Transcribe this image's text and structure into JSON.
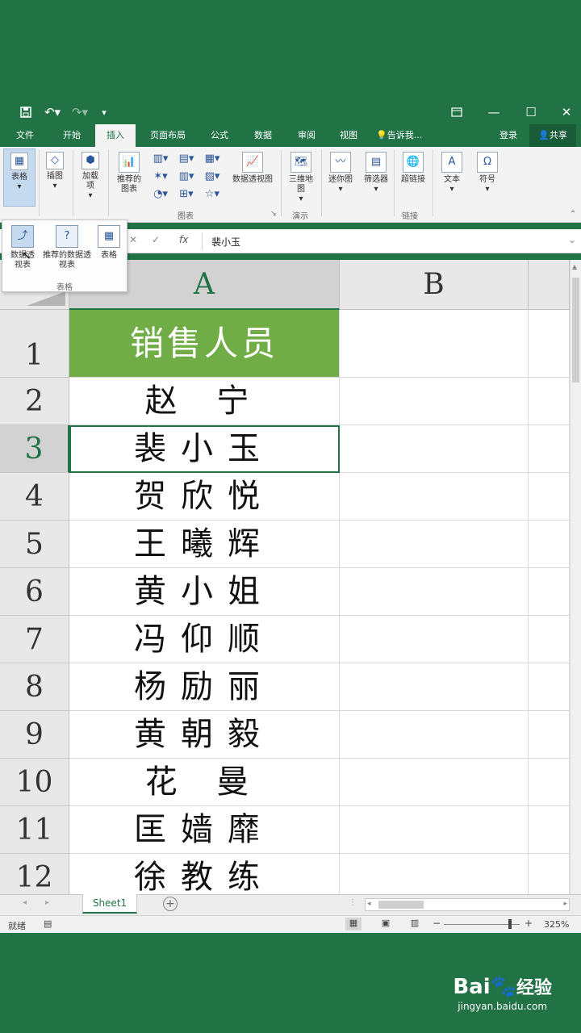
{
  "titlebar": {
    "save_icon": "save-icon",
    "undo_icon": "undo-icon",
    "redo_icon": "redo-icon"
  },
  "tabs": [
    "文件",
    "开始",
    "插入",
    "页面布局",
    "公式",
    "数据",
    "审阅",
    "视图"
  ],
  "tell_me": "告诉我...",
  "login": "登录",
  "share": "共享",
  "ribbon": {
    "table": "表格",
    "picture": "插图",
    "addins": "加载项",
    "recommended_charts": "推荐的图表",
    "pivot_chart": "数据透视图",
    "map3d": "三维地图",
    "sparkline": "迷你图",
    "slicer": "筛选器",
    "hyperlink": "超链接",
    "text": "文本",
    "symbol": "符号",
    "group_charts": "图表",
    "group_demo": "演示",
    "group_links": "链接"
  },
  "dropdown": {
    "pivot_table": "数据透视表",
    "recommended_pivot": "推荐的数据透视表",
    "table": "表格",
    "group_label": "表格"
  },
  "formula_bar": {
    "fx": "fx",
    "value": "裴小玉"
  },
  "columns": [
    "A",
    "B"
  ],
  "rows": [
    {
      "n": "1",
      "a": "销售人员"
    },
    {
      "n": "2",
      "a": "赵 宁"
    },
    {
      "n": "3",
      "a": "裴小玉"
    },
    {
      "n": "4",
      "a": "贺欣悦"
    },
    {
      "n": "5",
      "a": "王曦辉"
    },
    {
      "n": "6",
      "a": "黄小姐"
    },
    {
      "n": "7",
      "a": "冯仰顺"
    },
    {
      "n": "8",
      "a": "杨励丽"
    },
    {
      "n": "9",
      "a": "黄朝毅"
    },
    {
      "n": "10",
      "a": "花 曼"
    },
    {
      "n": "11",
      "a": "匡嫱靡"
    },
    {
      "n": "12",
      "a": "徐教练"
    }
  ],
  "sheet_tab": "Sheet1",
  "status": {
    "ready": "就绪",
    "zoom": "325%"
  },
  "watermark": {
    "brand": "Bai",
    "brand2": "经验",
    "url": "jingyan.baidu.com"
  },
  "colors": {
    "excel_green": "#217346",
    "header_fill": "#70ad47"
  }
}
